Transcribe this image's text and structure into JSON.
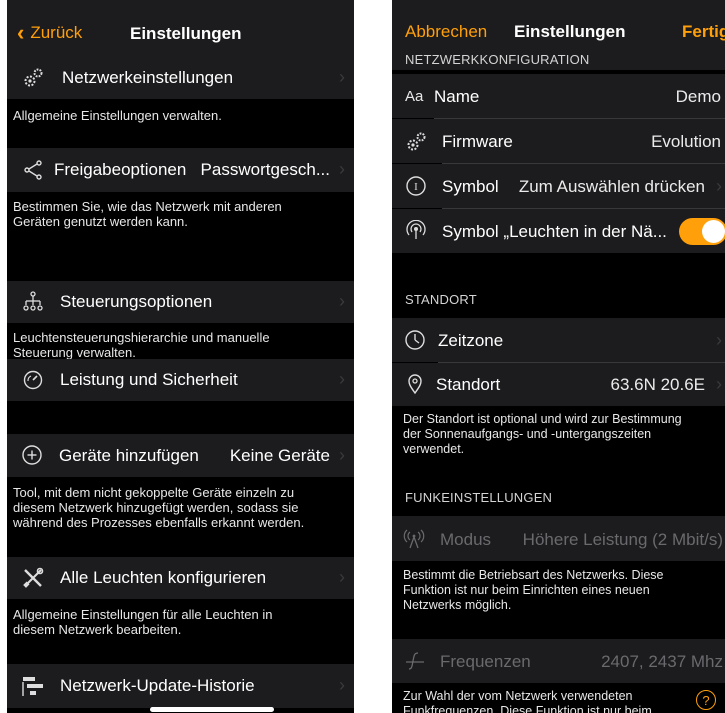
{
  "left": {
    "back_label": "Zurück",
    "title": "Einstellungen",
    "rows": {
      "network": {
        "label": "Netzwerkeinstellungen",
        "icon": "gears-icon",
        "footer": "Allgemeine Einstellungen verwalten."
      },
      "share": {
        "label": "Freigabeoptionen",
        "value": "Passwortgesch...",
        "icon": "share-icon",
        "footer_1": "Bestimmen Sie, wie das Netzwerk mit anderen",
        "footer_2": "Geräten genutzt werden kann."
      },
      "control": {
        "label": "Steuerungsoptionen",
        "icon": "hierarchy-icon",
        "footer_1": "Leuchtensteuerungshierarchie und manuelle",
        "footer_2": "Steuerung verwalten."
      },
      "performance": {
        "label": "Leistung und Sicherheit",
        "icon": "gauge-icon"
      },
      "add_devices": {
        "label": "Geräte hinzufügen",
        "value": "Keine Geräte",
        "icon": "plus-circle-icon",
        "footer_1": "Tool, mit dem nicht gekoppelte Geräte einzeln zu",
        "footer_2": "diesem Netzwerk hinzugefügt werden, sodass sie",
        "footer_3": "während des Prozesses ebenfalls erkannt werden."
      },
      "configure_all": {
        "label": "Alle Leuchten konfigurieren",
        "icon": "tools-icon",
        "footer_1": "Allgemeine Einstellungen für alle Leuchten in",
        "footer_2": "diesem Netzwerk bearbeiten."
      },
      "update_history": {
        "label": "Netzwerk-Update-Historie",
        "icon": "update-history-icon"
      }
    }
  },
  "right": {
    "cancel_label": "Abbrechen",
    "title": "Einstellungen",
    "done_label": "Fertig",
    "section_network": "NETZWERKKONFIGURATION",
    "name": {
      "label": "Name",
      "value": "Demo",
      "icon_text": "Aa"
    },
    "firmware": {
      "label": "Firmware",
      "value": "Evolution"
    },
    "symbol": {
      "label": "Symbol",
      "value": "Zum Auswählen drücken"
    },
    "symbol_proximity": {
      "label": "Symbol „Leuchten in der Nä...",
      "toggle_on": true
    },
    "section_location": "STANDORT",
    "timezone": {
      "label": "Zeitzone"
    },
    "location": {
      "label": "Standort",
      "value": "63.6N 20.6E",
      "footer_1": "Der Standort ist optional und wird zur Bestimmung",
      "footer_2": "der Sonnenaufgangs- und -untergangszeiten",
      "footer_3": "verwendet."
    },
    "section_radio": "FUNKEINSTELLUNGEN",
    "mode": {
      "label": "Modus",
      "value": "Höhere Leistung (2 Mbit/s)",
      "footer_1": "Bestimmt die Betriebsart des Netzwerks. Diese",
      "footer_2": "Funktion ist nur beim Einrichten eines neuen",
      "footer_3": "Netzwerks möglich."
    },
    "frequencies": {
      "label": "Frequenzen",
      "value": "2407, 2437 Mhz",
      "footer_1": "Zur Wahl der vom Netzwerk verwendeten",
      "footer_2": "Funkfrequenzen. Diese Funktion ist nur beim"
    }
  },
  "colors": {
    "accent": "#ff9f0a",
    "cell": "#1c1c1e",
    "background": "#000000"
  }
}
